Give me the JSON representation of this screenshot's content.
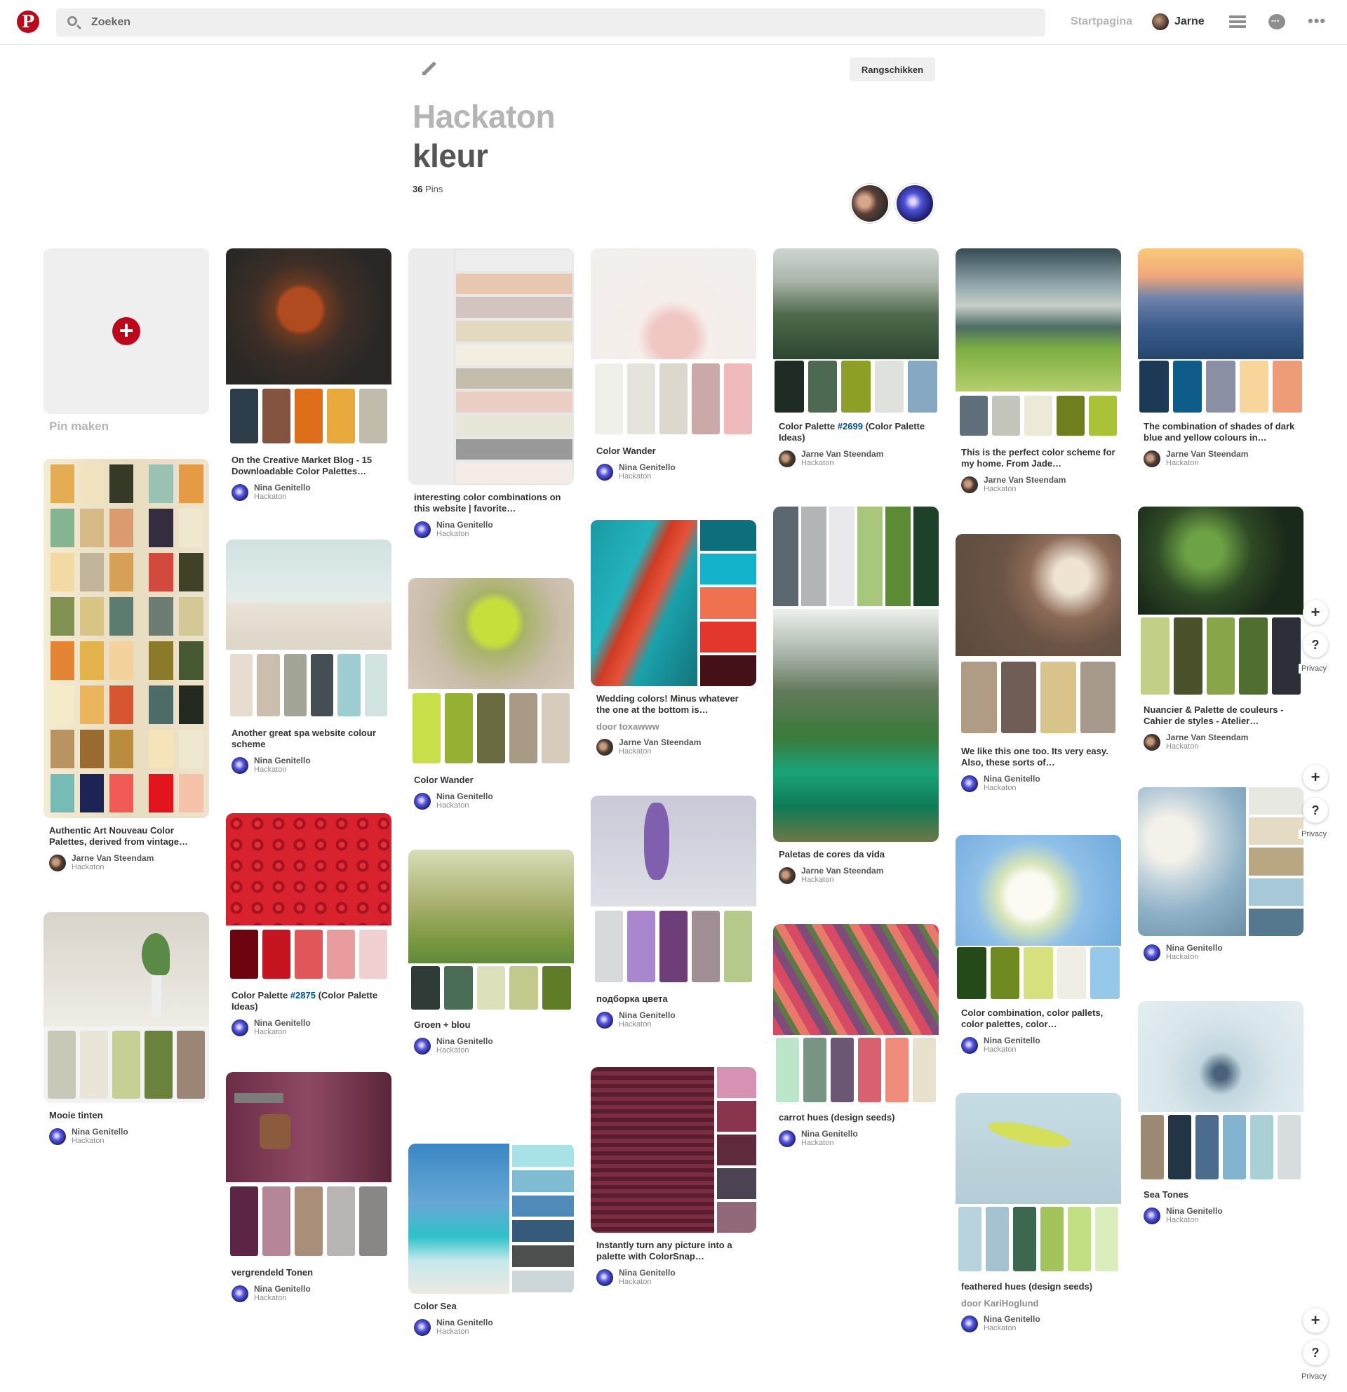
{
  "header": {
    "search_placeholder": "Zoeken",
    "home_label": "Startpagina",
    "user_name": "Jarne"
  },
  "board": {
    "arrange_label": "Rangschikken",
    "title_line1": "Hackaton",
    "title_line2": "kleur",
    "pin_count": "36",
    "pin_label": "Pins",
    "create_label": "Pin maken"
  },
  "side": {
    "plus": "+",
    "help": "?",
    "privacy": "Privacy"
  },
  "pins": [
    {
      "desc": "Authentic Art Nouveau Color Palettes, derived from vintage…",
      "name": "Jarne Van Steendam",
      "board": "Hackaton"
    },
    {
      "desc": "Mooie tinten",
      "name": "Nina Genitello",
      "board": "Hackaton"
    },
    {
      "desc": "On the Creative Market Blog - 15 Downloadable Color Palettes…",
      "name": "Nina Genitello",
      "board": "Hackaton"
    },
    {
      "desc": "Another great spa website colour scheme",
      "name": "Nina Genitello",
      "board": "Hackaton"
    },
    {
      "desc_pre": "Color Palette ",
      "desc_tag": "#2875",
      "desc_post": " (Color Palette Ideas)",
      "name": "Nina Genitello",
      "board": "Hackaton"
    },
    {
      "desc": "vergrendeld Tonen",
      "name": "Nina Genitello",
      "board": "Hackaton"
    },
    {
      "desc": "interesting color combinations on this website | favorite…",
      "name": "Nina Genitello",
      "board": "Hackaton"
    },
    {
      "desc": "Color Wander",
      "name": "Nina Genitello",
      "board": "Hackaton"
    },
    {
      "desc": "Groen + blou",
      "name": "Nina Genitello",
      "board": "Hackaton"
    },
    {
      "desc": "Color Sea",
      "name": "Nina Genitello",
      "board": "Hackaton"
    },
    {
      "desc": "Color Wander",
      "name": "Nina Genitello",
      "board": "Hackaton"
    },
    {
      "desc": "Wedding colors! Minus whatever the one at the bottom is…",
      "by": "door toxawww",
      "name": "Jarne Van Steendam",
      "board": "Hackaton"
    },
    {
      "desc": "подборка цвета",
      "name": "Nina Genitello",
      "board": "Hackaton"
    },
    {
      "desc": "Instantly turn any picture into a palette with ColorSnap…",
      "name": "Nina Genitello",
      "board": "Hackaton"
    },
    {
      "desc_pre": "Color Palette ",
      "desc_tag": "#2699",
      "desc_post": " (Color Palette Ideas)",
      "name": "Jarne Van Steendam",
      "board": "Hackaton"
    },
    {
      "desc": "Paletas de cores da vida",
      "name": "Jarne Van Steendam",
      "board": "Hackaton"
    },
    {
      "desc": "carrot hues (design seeds)",
      "name": "Nina Genitello",
      "board": "Hackaton"
    },
    {
      "desc": "This is the perfect color scheme for my home. From Jade…",
      "name": "Jarne Van Steendam",
      "board": "Hackaton"
    },
    {
      "desc": "We like this one too. Its very easy. Also, these sorts of…",
      "name": "Nina Genitello",
      "board": "Hackaton"
    },
    {
      "desc": "Color combination, color pallets, color palettes, color…",
      "name": "Nina Genitello",
      "board": "Hackaton"
    },
    {
      "desc": "feathered hues (design seeds)",
      "by": "door KariHoglund",
      "name": "Nina Genitello",
      "board": "Hackaton"
    },
    {
      "desc": "The combination of shades of dark blue and yellow colours in…",
      "name": "Jarne Van Steendam",
      "board": "Hackaton"
    },
    {
      "desc": "Nuancier & Palette de couleurs - Cahier de styles - Atelier…",
      "name": "Jarne Van Steendam",
      "board": "Hackaton"
    },
    {
      "name": "Nina Genitello",
      "board": "Hackaton"
    },
    {
      "desc": "Sea Tones",
      "name": "Nina Genitello",
      "board": "Hackaton"
    }
  ]
}
